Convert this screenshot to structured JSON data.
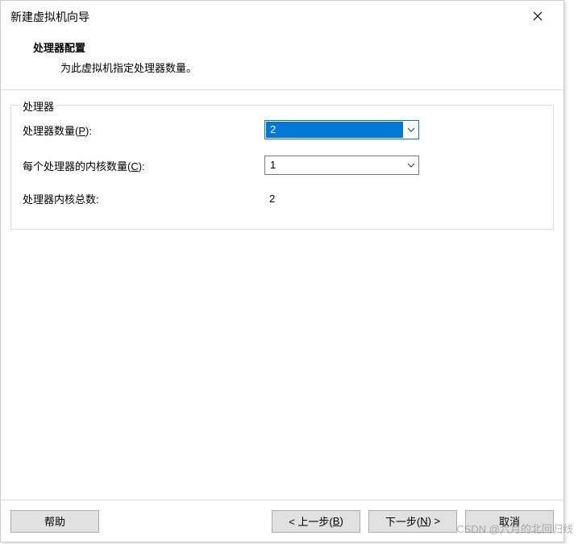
{
  "titlebar": {
    "title": "新建虚拟机向导"
  },
  "header": {
    "title": "处理器配置",
    "desc": "为此虚拟机指定处理器数量。"
  },
  "group": {
    "legend": "处理器",
    "rows": {
      "processors": {
        "label_pre": "处理器数量(",
        "hotkey": "P",
        "label_post": "):",
        "value": "2"
      },
      "cores": {
        "label_pre": "每个处理器的内核数量(",
        "hotkey": "C",
        "label_post": "):",
        "value": "1"
      },
      "total": {
        "label": "处理器内核总数:",
        "value": "2"
      }
    }
  },
  "buttons": {
    "help": "帮助",
    "back_pre": "< 上一步(",
    "back_hk": "B",
    "back_post": ")",
    "next_pre": "下一步(",
    "next_hk": "N",
    "next_post": ") >",
    "cancel": "取消"
  },
  "watermark": "CSDN @六月的北回归线"
}
